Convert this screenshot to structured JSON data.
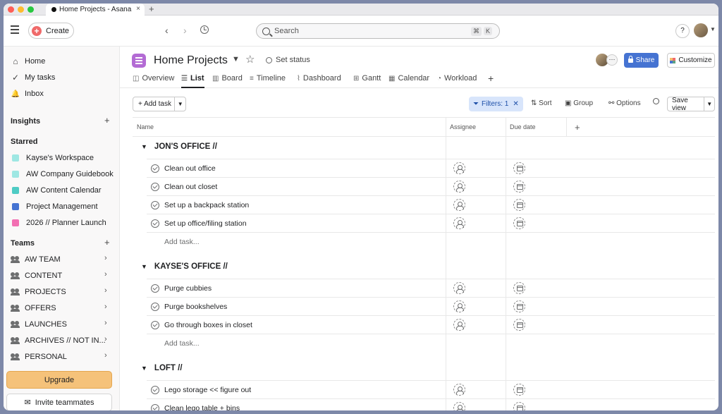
{
  "browser": {
    "tab_title": "Home Projects - Asana",
    "tab_close": "×",
    "new_tab": "+"
  },
  "topbar": {
    "create_label": "Create",
    "create_icon": "+",
    "back_arrow": "‹",
    "forward_arrow": "›",
    "search_placeholder": "Search",
    "shortcut_cmd": "⌘",
    "shortcut_key": "K",
    "help_label": "?"
  },
  "sidebar": {
    "nav": [
      {
        "label": "Home",
        "icon": "⌂"
      },
      {
        "label": "My tasks",
        "icon": "✓"
      },
      {
        "label": "Inbox",
        "icon": "🔔"
      }
    ],
    "insights_label": "Insights",
    "starred_label": "Starred",
    "starred": [
      {
        "label": "Kayse's Workspace",
        "color": "#9ee7e3"
      },
      {
        "label": "AW Company Guidebook",
        "color": "#9ee7e3"
      },
      {
        "label": "AW Content Calendar",
        "color": "#4ecbc4"
      },
      {
        "label": "Project Management",
        "color": "#4573d2"
      },
      {
        "label": "2026 // Planner Launch",
        "color": "#f26fb2"
      }
    ],
    "teams_label": "Teams",
    "teams": [
      {
        "label": "AW TEAM"
      },
      {
        "label": "CONTENT"
      },
      {
        "label": "PROJECTS"
      },
      {
        "label": "OFFERS"
      },
      {
        "label": "LAUNCHES"
      },
      {
        "label": "ARCHIVES // NOT IN..."
      },
      {
        "label": "PERSONAL"
      }
    ],
    "plus": "+",
    "chevron": "›",
    "upgrade_label": "Upgrade",
    "invite_label": "Invite teammates"
  },
  "project": {
    "title": "Home Projects",
    "set_status": "Set status",
    "share_label": "Share",
    "customize_label": "Customize",
    "more_members": "···",
    "tabs": [
      {
        "label": "Overview",
        "icon": "◫"
      },
      {
        "label": "List",
        "icon": "☰",
        "active": true
      },
      {
        "label": "Board",
        "icon": "▥"
      },
      {
        "label": "Timeline",
        "icon": "≡"
      },
      {
        "label": "Dashboard",
        "icon": "⌇"
      },
      {
        "label": "Gantt",
        "icon": "⊞"
      },
      {
        "label": "Calendar",
        "icon": "▦"
      },
      {
        "label": "Workload",
        "icon": "◔"
      }
    ],
    "add_tab": "+"
  },
  "toolbar": {
    "add_task": "+ Add task",
    "filters": "Filters: 1",
    "filters_clear": "✕",
    "sort": "⇅ Sort",
    "group": "▣ Group",
    "options": "⚯ Options",
    "search_icon": "search-icon",
    "save_view": "Save view"
  },
  "table": {
    "columns": [
      "Name",
      "Assignee",
      "Due date"
    ],
    "add_column": "+",
    "add_task_label": "Add task...",
    "sections": [
      {
        "name": "JON'S OFFICE //",
        "tasks": [
          "Clean out office",
          "Clean out closet",
          "Set up a backpack station",
          "Set up office/filing station"
        ]
      },
      {
        "name": "KAYSE'S OFFICE //",
        "tasks": [
          "Purge cubbies",
          "Purge bookshelves",
          "Go through boxes in closet"
        ]
      },
      {
        "name": "LOFT //",
        "tasks": [
          "Lego storage << figure out",
          "Clean lego table + bins"
        ]
      }
    ]
  }
}
